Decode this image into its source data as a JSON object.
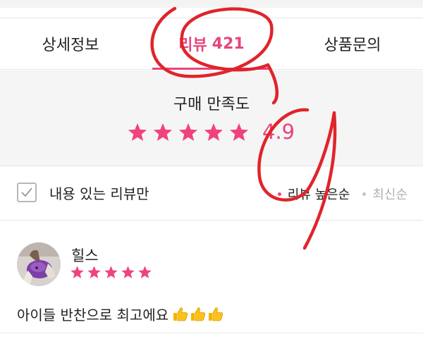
{
  "tabs": [
    {
      "label": "상세정보",
      "count": "",
      "active": false
    },
    {
      "label": "리뷰",
      "count": "421",
      "active": true
    },
    {
      "label": "상품문의",
      "count": "",
      "active": false
    }
  ],
  "summary": {
    "title": "구매 만족도",
    "rating": 5,
    "score": "4.9"
  },
  "filter": {
    "checkbox_label": "내용 있는 리뷰만",
    "checked": true,
    "sort_options": [
      {
        "label": "리뷰 높은순",
        "active": true
      },
      {
        "label": "최신순",
        "active": false
      }
    ]
  },
  "reviews": [
    {
      "name": "힐스",
      "rating": 5,
      "text": "아이들 반찬으로 최고에요",
      "emoji": "thumbs-up-icon",
      "emoji_count": 3
    }
  ],
  "annotation": {
    "marks": [
      "9",
      "9"
    ],
    "color": "#e0242b"
  },
  "colors": {
    "accent": "#e8447d",
    "star": "#f0437c"
  }
}
